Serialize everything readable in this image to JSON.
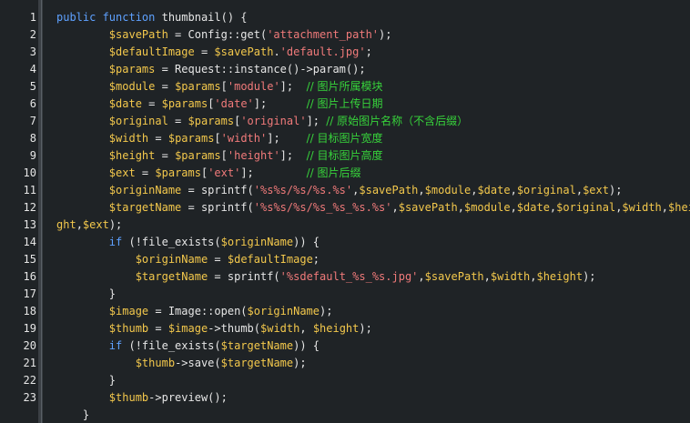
{
  "editor": {
    "background": "#1f2326",
    "colors": {
      "keyword": "#5ea1ff",
      "variable": "#f3c84c",
      "string": "#f07a7a",
      "comment": "#37d33b",
      "plain": "#e6e6e6"
    },
    "line_numbers": [
      "1",
      "2",
      "3",
      "4",
      "5",
      "6",
      "7",
      "8",
      "9",
      "10",
      "11",
      "12",
      "13",
      "14",
      "15",
      "16",
      "17",
      "18",
      "19",
      "20",
      "21",
      "22",
      "23"
    ],
    "lines": [
      [
        [
          "kw",
          "public function "
        ],
        [
          "pl",
          "thumbnail() {"
        ]
      ],
      [
        [
          "pl",
          "        "
        ],
        [
          "var",
          "$savePath"
        ],
        [
          "pl",
          " = Config::get("
        ],
        [
          "str",
          "'attachment_path'"
        ],
        [
          "pl",
          ");"
        ]
      ],
      [
        [
          "pl",
          "        "
        ],
        [
          "var",
          "$defaultImage"
        ],
        [
          "pl",
          " = "
        ],
        [
          "var",
          "$savePath"
        ],
        [
          "pl",
          "."
        ],
        [
          "str",
          "'default.jpg'"
        ],
        [
          "pl",
          ";"
        ]
      ],
      [
        [
          "pl",
          "        "
        ],
        [
          "var",
          "$params"
        ],
        [
          "pl",
          " = Request::instance()->param();"
        ]
      ],
      [
        [
          "pl",
          "        "
        ],
        [
          "var",
          "$module"
        ],
        [
          "pl",
          " = "
        ],
        [
          "var",
          "$params"
        ],
        [
          "pl",
          "["
        ],
        [
          "str",
          "'module'"
        ],
        [
          "pl",
          "];  "
        ],
        [
          "cm",
          "// 图片所属模块"
        ]
      ],
      [
        [
          "pl",
          "        "
        ],
        [
          "var",
          "$date"
        ],
        [
          "pl",
          " = "
        ],
        [
          "var",
          "$params"
        ],
        [
          "pl",
          "["
        ],
        [
          "str",
          "'date'"
        ],
        [
          "pl",
          "];      "
        ],
        [
          "cm",
          "// 图片上传日期"
        ]
      ],
      [
        [
          "pl",
          "        "
        ],
        [
          "var",
          "$original"
        ],
        [
          "pl",
          " = "
        ],
        [
          "var",
          "$params"
        ],
        [
          "pl",
          "["
        ],
        [
          "str",
          "'original'"
        ],
        [
          "pl",
          "]; "
        ],
        [
          "cm",
          "// 原始图片名称（不含后缀）"
        ]
      ],
      [
        [
          "pl",
          "        "
        ],
        [
          "var",
          "$width"
        ],
        [
          "pl",
          " = "
        ],
        [
          "var",
          "$params"
        ],
        [
          "pl",
          "["
        ],
        [
          "str",
          "'width'"
        ],
        [
          "pl",
          "];    "
        ],
        [
          "cm",
          "// 目标图片宽度"
        ]
      ],
      [
        [
          "pl",
          "        "
        ],
        [
          "var",
          "$height"
        ],
        [
          "pl",
          " = "
        ],
        [
          "var",
          "$params"
        ],
        [
          "pl",
          "["
        ],
        [
          "str",
          "'height'"
        ],
        [
          "pl",
          "];  "
        ],
        [
          "cm",
          "// 目标图片高度"
        ]
      ],
      [
        [
          "pl",
          "        "
        ],
        [
          "var",
          "$ext"
        ],
        [
          "pl",
          " = "
        ],
        [
          "var",
          "$params"
        ],
        [
          "pl",
          "["
        ],
        [
          "str",
          "'ext'"
        ],
        [
          "pl",
          "];        "
        ],
        [
          "cm",
          "// 图片后缀"
        ]
      ],
      [
        [
          "pl",
          "        "
        ],
        [
          "var",
          "$originName"
        ],
        [
          "pl",
          " = sprintf("
        ],
        [
          "str",
          "'%s%s/%s/%s.%s'"
        ],
        [
          "pl",
          ","
        ],
        [
          "var",
          "$savePath"
        ],
        [
          "pl",
          ","
        ],
        [
          "var",
          "$module"
        ],
        [
          "pl",
          ","
        ],
        [
          "var",
          "$date"
        ],
        [
          "pl",
          ","
        ],
        [
          "var",
          "$original"
        ],
        [
          "pl",
          ","
        ],
        [
          "var",
          "$ext"
        ],
        [
          "pl",
          ");"
        ]
      ],
      [
        [
          "pl",
          "        "
        ],
        [
          "var",
          "$targetName"
        ],
        [
          "pl",
          " = sprintf("
        ],
        [
          "str",
          "'%s%s/%s/%s_%s_%s.%s'"
        ],
        [
          "pl",
          ","
        ],
        [
          "var",
          "$savePath"
        ],
        [
          "pl",
          ","
        ],
        [
          "var",
          "$module"
        ],
        [
          "pl",
          ","
        ],
        [
          "var",
          "$date"
        ],
        [
          "pl",
          ","
        ],
        [
          "var",
          "$original"
        ],
        [
          "pl",
          ","
        ],
        [
          "var",
          "$width"
        ],
        [
          "pl",
          ","
        ],
        [
          "var",
          "$hei"
        ]
      ],
      [
        [
          "var",
          "ght"
        ],
        [
          "pl",
          ","
        ],
        [
          "var",
          "$ext"
        ],
        [
          "pl",
          ");"
        ]
      ],
      [
        [
          "pl",
          "        "
        ],
        [
          "kw",
          "if"
        ],
        [
          "pl",
          " (!file_exists("
        ],
        [
          "var",
          "$originName"
        ],
        [
          "pl",
          ")) {"
        ]
      ],
      [
        [
          "pl",
          "            "
        ],
        [
          "var",
          "$originName"
        ],
        [
          "pl",
          " = "
        ],
        [
          "var",
          "$defaultImage"
        ],
        [
          "pl",
          ";"
        ]
      ],
      [
        [
          "pl",
          "            "
        ],
        [
          "var",
          "$targetName"
        ],
        [
          "pl",
          " = sprintf("
        ],
        [
          "str",
          "'%sdefault_%s_%s.jpg'"
        ],
        [
          "pl",
          ","
        ],
        [
          "var",
          "$savePath"
        ],
        [
          "pl",
          ","
        ],
        [
          "var",
          "$width"
        ],
        [
          "pl",
          ","
        ],
        [
          "var",
          "$height"
        ],
        [
          "pl",
          ");"
        ]
      ],
      [
        [
          "pl",
          "        }"
        ]
      ],
      [
        [
          "pl",
          "        "
        ],
        [
          "var",
          "$image"
        ],
        [
          "pl",
          " = Image::open("
        ],
        [
          "var",
          "$originName"
        ],
        [
          "pl",
          ");"
        ]
      ],
      [
        [
          "pl",
          "        "
        ],
        [
          "var",
          "$thumb"
        ],
        [
          "pl",
          " = "
        ],
        [
          "var",
          "$image"
        ],
        [
          "pl",
          "->thumb("
        ],
        [
          "var",
          "$width"
        ],
        [
          "pl",
          ", "
        ],
        [
          "var",
          "$height"
        ],
        [
          "pl",
          ");"
        ]
      ],
      [
        [
          "pl",
          "        "
        ],
        [
          "kw",
          "if"
        ],
        [
          "pl",
          " (!file_exists("
        ],
        [
          "var",
          "$targetName"
        ],
        [
          "pl",
          ")) {"
        ]
      ],
      [
        [
          "pl",
          "            "
        ],
        [
          "var",
          "$thumb"
        ],
        [
          "pl",
          "->save("
        ],
        [
          "var",
          "$targetName"
        ],
        [
          "pl",
          ");"
        ]
      ],
      [
        [
          "pl",
          "        }"
        ]
      ],
      [
        [
          "pl",
          "        "
        ],
        [
          "var",
          "$thumb"
        ],
        [
          "pl",
          "->preview();"
        ]
      ],
      [
        [
          "pl",
          "    }"
        ]
      ]
    ]
  }
}
